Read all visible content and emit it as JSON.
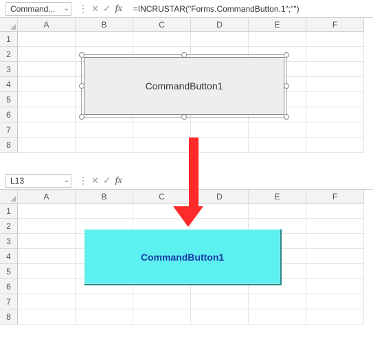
{
  "panels": [
    {
      "namebox": "Command...",
      "formula": "=INCRUSTAR(\"Forms.CommandButton.1\";\"\")",
      "columns": [
        "A",
        "B",
        "C",
        "D",
        "E",
        "F"
      ],
      "rows": [
        "1",
        "2",
        "3",
        "4",
        "5",
        "6",
        "7",
        "8"
      ],
      "button_label": "CommandButton1",
      "button_style": "design",
      "selected": true
    },
    {
      "namebox": "L13",
      "formula": "",
      "columns": [
        "A",
        "B",
        "C",
        "D",
        "E",
        "F"
      ],
      "rows": [
        "1",
        "2",
        "3",
        "4",
        "5",
        "6",
        "7",
        "8"
      ],
      "button_label": "CommandButton1",
      "button_style": "styled",
      "selected": false
    }
  ],
  "icons": {
    "chevron_down": "⌄",
    "dots": "⋮",
    "x": "✕",
    "check": "✓",
    "fx": "fx"
  }
}
